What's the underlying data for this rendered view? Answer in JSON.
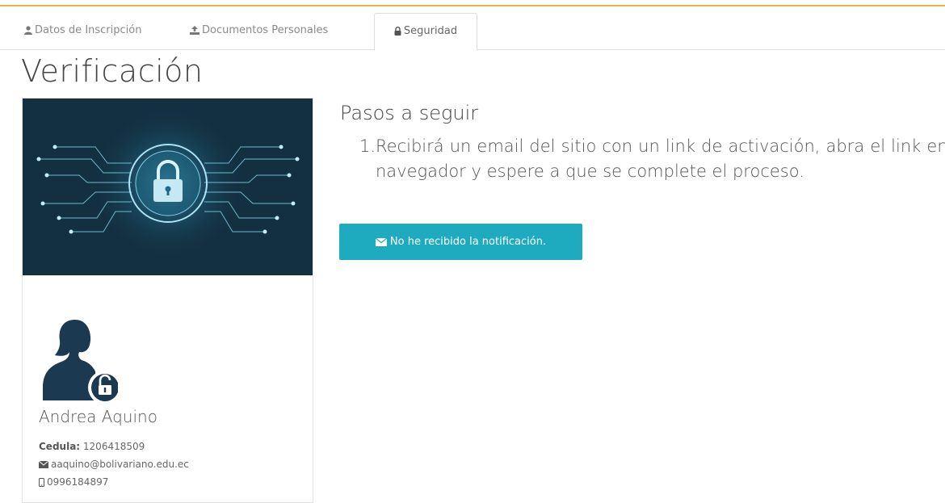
{
  "tabs": [
    {
      "label": "Datos de Inscripción",
      "icon": "user-icon"
    },
    {
      "label": "Documentos Personales",
      "icon": "upload-icon"
    },
    {
      "label": "Seguridad",
      "icon": "lock-icon",
      "active": true
    }
  ],
  "page": {
    "title": "Verificación"
  },
  "profile": {
    "name": "Andrea Aquino",
    "cedula_label": "Cedula:",
    "cedula_value": " 1206418509",
    "email": "aaquino@bolivariano.edu.ec",
    "phone": "0996184897",
    "avatar_icon": "user-unlock-icon"
  },
  "steps": {
    "title": "Pasos a seguir",
    "items": [
      {
        "number": "1.",
        "text": "Recibirá un email del sitio con un link de activación, abra el link en su navegador y espere a que se complete el proceso."
      }
    ]
  },
  "resend_button": {
    "label": "No he recibido la notificación.",
    "icon": "envelope-icon"
  },
  "colors": {
    "accent": "#1eabbf",
    "top_border": "#e6b24a",
    "hero_bg": "#143344",
    "avatar": "#1b3a52"
  }
}
